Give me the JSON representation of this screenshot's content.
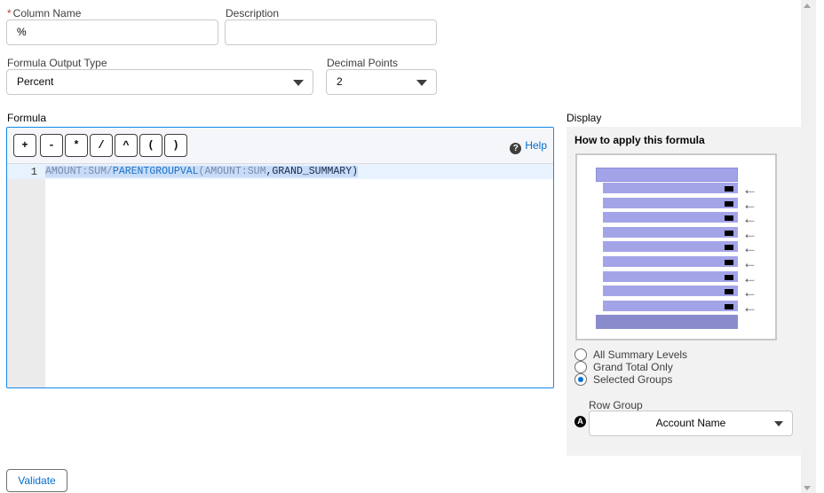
{
  "column_name": {
    "label": "Column Name",
    "required_mark": "*",
    "value": "%"
  },
  "description": {
    "label": "Description",
    "value": ""
  },
  "output_type": {
    "label": "Formula Output Type",
    "value": "Percent"
  },
  "decimal_points": {
    "label": "Decimal Points",
    "value": "2"
  },
  "formula": {
    "label": "Formula",
    "operators": [
      "+",
      "-",
      "*",
      "/",
      "^",
      "(",
      ")"
    ],
    "help_label": "Help",
    "line_number": "1",
    "tokens": [
      "AMOUNT:SUM",
      "/",
      "PARENTGROUPVAL",
      "(",
      "AMOUNT:SUM",
      ",",
      "GRAND_SUMMARY",
      ")"
    ]
  },
  "display": {
    "label": "Display",
    "heading": "How to apply this formula",
    "options": [
      "All Summary Levels",
      "Grand Total Only",
      "Selected Groups"
    ],
    "selected_option": "Selected Groups",
    "row_group_label": "Row Group",
    "row_group_value": "Account Name",
    "row_group_badge": "A",
    "diagram_colors": {
      "row": "#a3a4e8",
      "footer": "#8a8bcc",
      "marker": "#000000"
    }
  },
  "validate_label": "Validate",
  "colors": {
    "focus": "#1589ee",
    "link": "#006dcc",
    "radio_checked": "#0070d2"
  }
}
